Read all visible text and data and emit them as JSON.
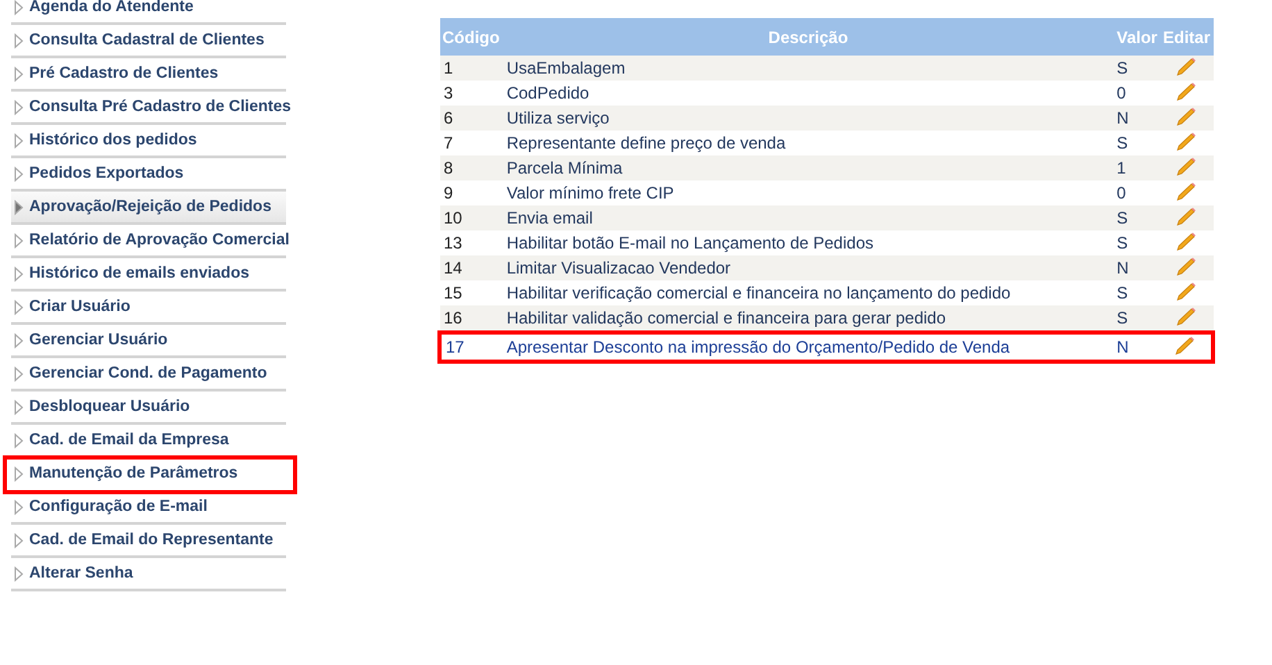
{
  "sidebar": {
    "items": [
      {
        "label": "Agenda do Atendente",
        "selected": false,
        "highlighted": false
      },
      {
        "label": "Consulta Cadastral de Clientes",
        "selected": false,
        "highlighted": false
      },
      {
        "label": "Pré Cadastro de Clientes",
        "selected": false,
        "highlighted": false
      },
      {
        "label": "Consulta Pré Cadastro de Clientes",
        "selected": false,
        "highlighted": false
      },
      {
        "label": "Histórico dos pedidos",
        "selected": false,
        "highlighted": false
      },
      {
        "label": "Pedidos Exportados",
        "selected": false,
        "highlighted": false
      },
      {
        "label": "Aprovação/Rejeição de Pedidos",
        "selected": true,
        "highlighted": false
      },
      {
        "label": "Relatório de Aprovação Comercial",
        "selected": false,
        "highlighted": false
      },
      {
        "label": "Histórico de emails enviados",
        "selected": false,
        "highlighted": false
      },
      {
        "label": "Criar Usuário",
        "selected": false,
        "highlighted": false
      },
      {
        "label": "Gerenciar Usuário",
        "selected": false,
        "highlighted": false
      },
      {
        "label": "Gerenciar Cond. de Pagamento",
        "selected": false,
        "highlighted": false
      },
      {
        "label": "Desbloquear Usuário",
        "selected": false,
        "highlighted": false
      },
      {
        "label": "Cad. de Email da Empresa",
        "selected": false,
        "highlighted": false
      },
      {
        "label": "Manutenção de Parâmetros",
        "selected": false,
        "highlighted": true
      },
      {
        "label": "Configuração de E-mail",
        "selected": false,
        "highlighted": false
      },
      {
        "label": "Cad. de Email do Representante",
        "selected": false,
        "highlighted": false
      },
      {
        "label": "Alterar Senha",
        "selected": false,
        "highlighted": false
      }
    ]
  },
  "table": {
    "columns": [
      "Código",
      "Descrição",
      "Valor",
      "Editar"
    ],
    "rows": [
      {
        "code": "1",
        "description": "UsaEmbalagem",
        "value": "S",
        "highlighted": false
      },
      {
        "code": "3",
        "description": "CodPedido",
        "value": "0",
        "highlighted": false
      },
      {
        "code": "6",
        "description": "Utiliza serviço",
        "value": "N",
        "highlighted": false
      },
      {
        "code": "7",
        "description": "Representante define preço de venda",
        "value": "S",
        "highlighted": false
      },
      {
        "code": "8",
        "description": "Parcela Mínima",
        "value": "1",
        "highlighted": false
      },
      {
        "code": "9",
        "description": "Valor mínimo frete CIP",
        "value": "0",
        "highlighted": false
      },
      {
        "code": "10",
        "description": "Envia email",
        "value": "S",
        "highlighted": false
      },
      {
        "code": "13",
        "description": "Habilitar botão E-mail no Lançamento de Pedidos",
        "value": "S",
        "highlighted": false
      },
      {
        "code": "14",
        "description": "Limitar Visualizacao Vendedor",
        "value": "N",
        "highlighted": false
      },
      {
        "code": "15",
        "description": "Habilitar verificação comercial e financeira no lançamento do pedido",
        "value": "S",
        "highlighted": false
      },
      {
        "code": "16",
        "description": "Habilitar validação comercial e financeira para gerar pedido",
        "value": "S",
        "highlighted": false
      },
      {
        "code": "17",
        "description": "Apresentar Desconto na impressão do Orçamento/Pedido de Venda",
        "value": "N",
        "highlighted": true
      }
    ]
  }
}
